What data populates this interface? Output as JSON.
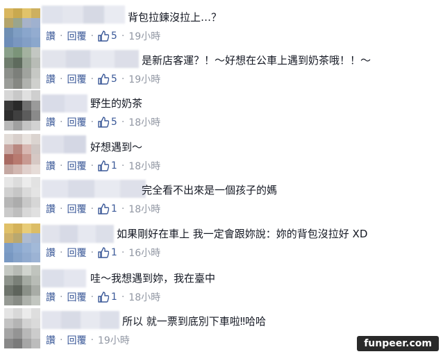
{
  "comments": [
    {
      "text": "背包拉鍊沒拉上…？",
      "like": "讚",
      "reply": "回覆",
      "likes": "5",
      "time": "19小時"
    },
    {
      "text": "是新店客運？！～好想在公車上遇到奶茶哦！！～",
      "like": "讚",
      "reply": "回覆",
      "likes": "5",
      "time": "19小時"
    },
    {
      "text": "野生的奶茶",
      "like": "讚",
      "reply": "回覆",
      "likes": "5",
      "time": "18小時"
    },
    {
      "text": "好想遇到～",
      "like": "讚",
      "reply": "回覆",
      "likes": "1",
      "time": "18小時"
    },
    {
      "text": "完全看不出來是一個孩子的媽",
      "like": "讚",
      "reply": "回覆",
      "likes": "1",
      "time": "18小時"
    },
    {
      "text": "如果剛好在車上 我一定會跟妳說：妳的背包沒拉好 XD",
      "like": "讚",
      "reply": "回覆",
      "likes": "1",
      "time": "16小時"
    },
    {
      "text": "哇～我想遇到妳，我在臺中",
      "like": "讚",
      "reply": "回覆",
      "likes": "1",
      "time": "18小時"
    },
    {
      "text": "所以 就一票到底別下車啦‼哈哈",
      "like": "讚",
      "reply": "回覆",
      "likes": "",
      "time": "19小時"
    }
  ],
  "watermark": "funpeer.com",
  "colors": {
    "link": "#3b5998",
    "meta": "#9197a3",
    "text": "#141823"
  }
}
